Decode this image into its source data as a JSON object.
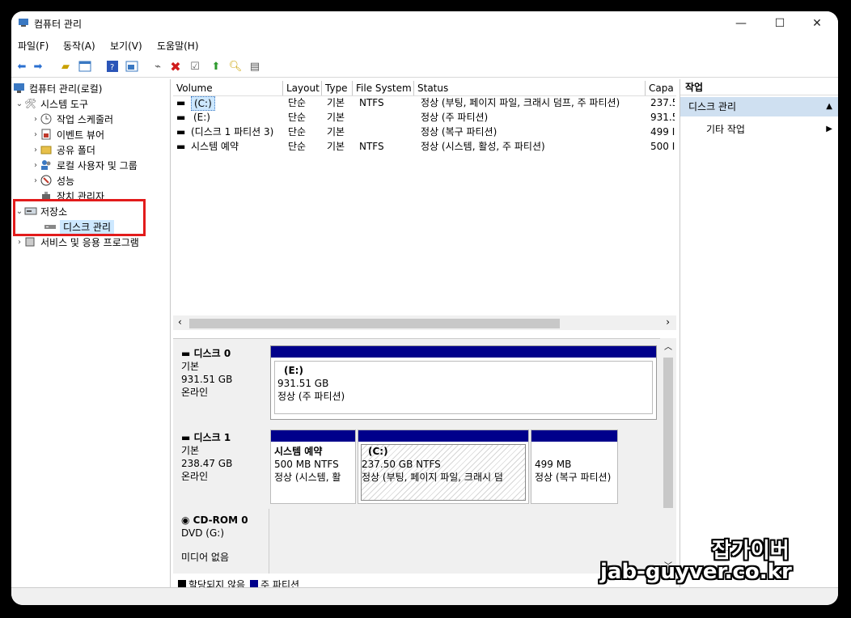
{
  "window": {
    "title": "컴퓨터 관리"
  },
  "menu": [
    "파일(F)",
    "동작(A)",
    "보기(V)",
    "도움말(H)"
  ],
  "toolbar": [
    "back-icon",
    "forward-icon",
    "up-folder-icon",
    "show-tree-icon",
    "help-icon",
    "console-icon",
    "connect-icon",
    "delete-icon",
    "check-icon",
    "export-icon",
    "search-icon",
    "properties-icon"
  ],
  "tree": {
    "root": "컴퓨터 관리(로컬)",
    "system_tools": "시스템 도구",
    "task_scheduler": "작업 스케줄러",
    "event_viewer": "이벤트 뷰어",
    "shared_folders": "공유 폴더",
    "local_users": "로컬 사용자 및 그룹",
    "performance": "성능",
    "device_manager": "장치 관리자",
    "storage": "저장소",
    "disk_management": "디스크 관리",
    "services_apps": "서비스 및 응용 프로그램"
  },
  "volume_list": {
    "columns": [
      "Volume",
      "Layout",
      "Type",
      "File System",
      "Status",
      "Capa"
    ],
    "rows": [
      [
        "(C:)",
        "단순",
        "기본",
        "NTFS",
        "정상 (부팅, 페이지 파일, 크래시 덤프, 주 파티션)",
        "237.5"
      ],
      [
        "(E:)",
        "단순",
        "기본",
        "",
        "정상 (주 파티션)",
        "931.5"
      ],
      [
        "(디스크 1 파티션 3)",
        "단순",
        "기본",
        "",
        "정상 (복구 파티션)",
        "499 I"
      ],
      [
        "시스템 예약",
        "단순",
        "기본",
        "NTFS",
        "정상 (시스템, 활성, 주 파티션)",
        "500 I"
      ]
    ]
  },
  "disks": {
    "disk0": {
      "name": "디스크 0",
      "type": "기본",
      "size": "931.51 GB",
      "state": "온라인",
      "part": {
        "label": "(E:)",
        "size": "931.51 GB",
        "status": "정상 (주 파티션)"
      }
    },
    "disk1": {
      "name": "디스크 1",
      "type": "기본",
      "size": "238.47 GB",
      "state": "온라인",
      "p1": {
        "label": "시스템 예약",
        "size": "500 MB NTFS",
        "status": "정상 (시스템, 활"
      },
      "p2": {
        "label": "(C:)",
        "size": "237.50 GB NTFS",
        "status": "정상 (부팅, 페이지 파일, 크래시 덤"
      },
      "p3": {
        "size": "499 MB",
        "status": "정상 (복구 파티션)"
      }
    },
    "cdrom0": {
      "name": "CD-ROM 0",
      "type": "DVD (G:)",
      "state": "미디어 없음"
    }
  },
  "legend": {
    "unallocated": "할당되지 않음",
    "primary": "주 파티션"
  },
  "actions": {
    "header": "작업",
    "section": "디스크 관리",
    "item": "기타 작업"
  },
  "watermark": {
    "line1": "잡가이버",
    "line2": "jab-guyver.co.kr"
  },
  "colors": {
    "partition_bar": "#00008b",
    "selection": "#cde8ff",
    "highlight_box": "#e21b1b"
  }
}
